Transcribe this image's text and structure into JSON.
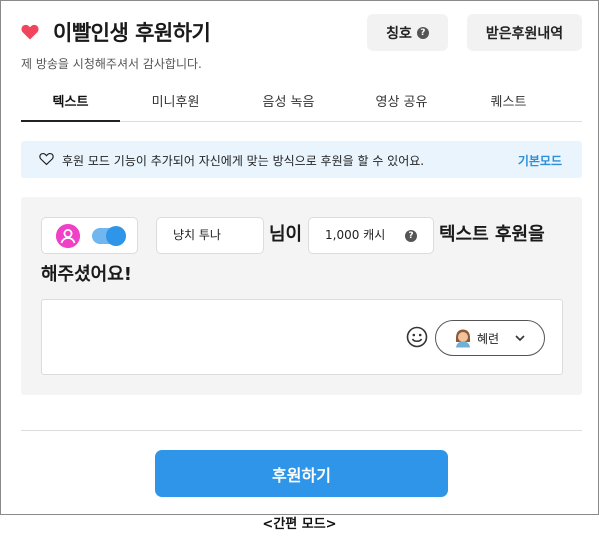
{
  "header": {
    "title": "이빨인생 후원하기",
    "subtitle": "제 방송을 시청해주셔서 감사합니다.",
    "title_button": "칭호",
    "history_button": "받은후원내역"
  },
  "tabs": [
    {
      "label": "텍스트",
      "active": true
    },
    {
      "label": "미니후원",
      "active": false
    },
    {
      "label": "음성 녹음",
      "active": false
    },
    {
      "label": "영상 공유",
      "active": false
    },
    {
      "label": "퀘스트",
      "active": false
    }
  ],
  "notice": {
    "text": "후원 모드 기능이 추가되어 자신에게 맞는 방식으로 후원을 할 수 있어요.",
    "link": "기본모드"
  },
  "form": {
    "nickname": "냥치 투나",
    "nim_label": "님이",
    "amount": "1,000 캐시",
    "sentence_end": "텍스트 후원을",
    "sentence_line2": "해주셨어요!",
    "voice_name": "혜련"
  },
  "donate_button": "후원하기",
  "caption": "<간편 모드>",
  "colors": {
    "accent": "#2e95e8",
    "heart": "#f0455a",
    "avatar": "#f040c8",
    "notice_bg": "#e9f4fc"
  },
  "icons": {
    "heart": "heart-icon",
    "help": "help-icon",
    "emoji": "emoji-icon",
    "chevron": "chevron-down-icon"
  }
}
